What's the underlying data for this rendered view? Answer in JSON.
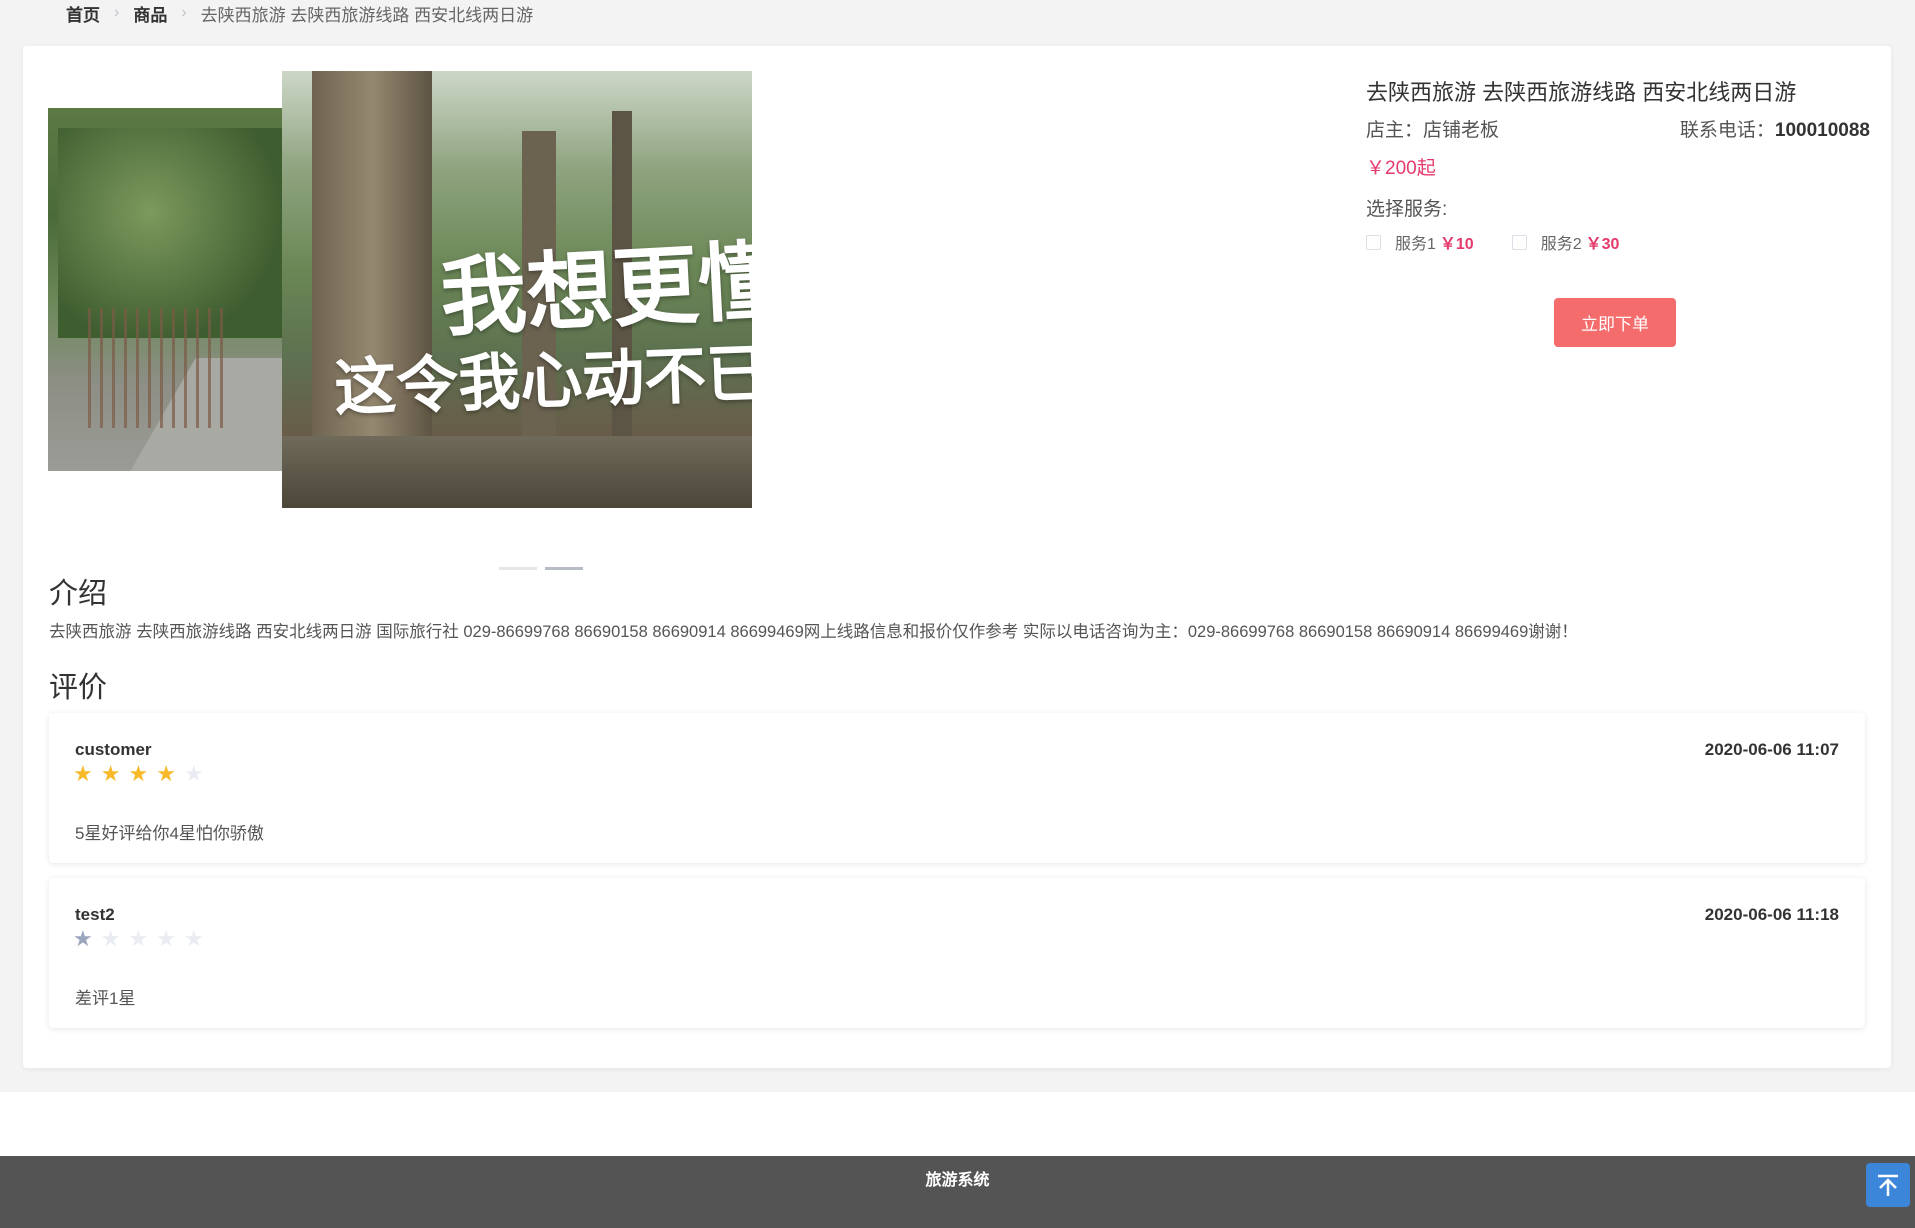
{
  "breadcrumb": {
    "home": "首页",
    "goods": "商品",
    "current": "去陕西旅游 去陕西旅游线路 西安北线两日游"
  },
  "carousel": {
    "slide_text_line1": "我想更懂",
    "slide_text_line2": "这令我心动不已的",
    "active_index": 1,
    "slide_count": 2
  },
  "product": {
    "title": "去陕西旅游 去陕西旅游线路 西安北线两日游",
    "owner_label": "店主：",
    "owner": "店铺老板",
    "phone_label": "联系电话：",
    "phone": "100010088",
    "price": "￥200起",
    "services_label": "选择服务:",
    "services": [
      {
        "name": "服务1",
        "price": "￥10"
      },
      {
        "name": "服务2",
        "price": "￥30"
      }
    ],
    "order_button": "立即下单"
  },
  "intro": {
    "title": "介绍",
    "text": "去陕西旅游 去陕西旅游线路 西安北线两日游 国际旅行社 029-86699768 86690158 86690914 86699469网上线路信息和报价仅作参考 实际以电话咨询为主：029-86699768 86690158 86690914 86699469谢谢！"
  },
  "reviews": {
    "title": "评价",
    "items": [
      {
        "user": "customer",
        "date": "2020-06-06 11:07",
        "rating": 4,
        "comment": "5星好评给你4星怕你骄傲"
      },
      {
        "user": "test2",
        "date": "2020-06-06 11:18",
        "rating": 1,
        "comment": "差评1星"
      }
    ]
  },
  "footer": {
    "text": "旅游系统"
  },
  "colors": {
    "accent_price": "#e6396b",
    "order_button": "#f56c6c",
    "star_active": "#f7ba2a",
    "star_low": "#9aa6bd",
    "footer_bg": "#545454",
    "back_top": "#3b86d8"
  },
  "icons": {
    "breadcrumb_separator": "chevron-right-icon",
    "back_top": "arrow-up-to-top-icon",
    "rating": "star-icon"
  }
}
